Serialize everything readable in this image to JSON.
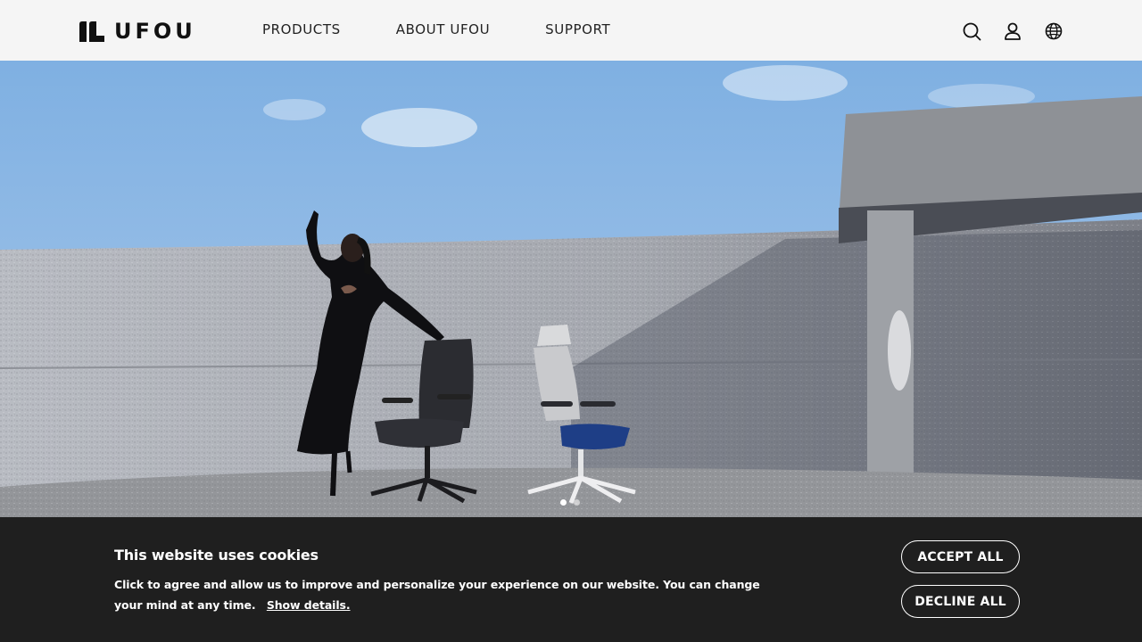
{
  "brand": {
    "name": "UFOU"
  },
  "nav": {
    "items": [
      {
        "label": "PRODUCTS"
      },
      {
        "label": "ABOUT UFOU"
      },
      {
        "label": "SUPPORT"
      }
    ]
  },
  "header_icons": [
    "search-icon",
    "user-icon",
    "globe-icon"
  ],
  "hero": {
    "slide_count": 2,
    "active_slide": 1
  },
  "cookie_banner": {
    "title": "This website uses cookies",
    "text": "Click to agree and allow us to improve and personalize your experience on our website. You can change your mind at any time.",
    "details_link": "Show details.",
    "accept_label": "ACCEPT ALL",
    "decline_label": "DECLINE ALL"
  },
  "colors": {
    "header_bg": "#f5f5f5",
    "banner_bg": "#1f1f1f",
    "text_dark": "#111111",
    "sky": "#8fb9e4"
  }
}
